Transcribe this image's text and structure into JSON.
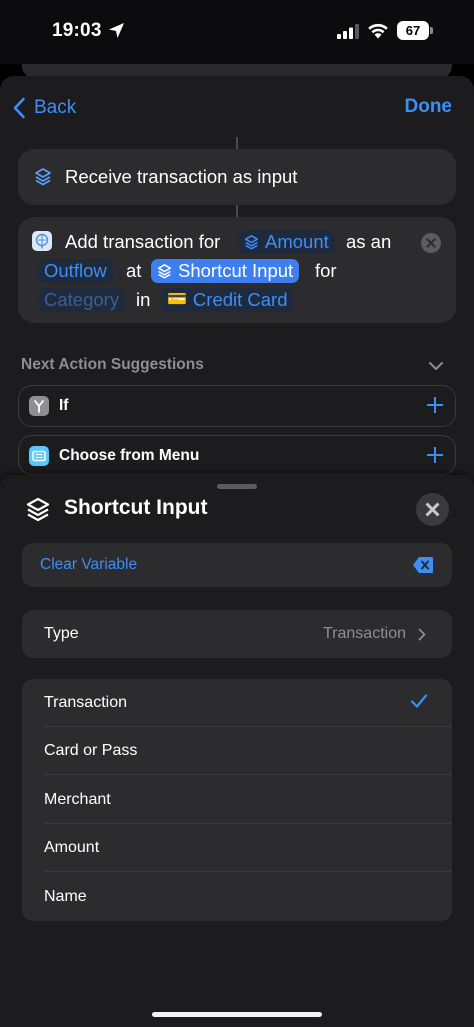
{
  "status_bar": {
    "time": "19:03",
    "battery": "67",
    "icons": [
      "location-arrow-icon",
      "cellular-signal-icon",
      "wifi-icon",
      "battery-icon"
    ]
  },
  "nav": {
    "back_label": "Back",
    "done_label": "Done"
  },
  "actions": {
    "receive": {
      "label": "Receive transaction as input",
      "icon": "shortcuts-icon"
    },
    "add_transaction": {
      "icon": "wallet-app-icon",
      "text_1": "Add transaction for",
      "amount_token": "Amount",
      "text_2": "as an",
      "direction_token": "Outflow",
      "text_3": "at",
      "shortcut_input_token": "Shortcut Input",
      "text_4": "for",
      "category_token": "Category",
      "text_5": "in",
      "card_emoji": "💳",
      "account_token": "Credit Card"
    }
  },
  "suggestions": {
    "title": "Next Action Suggestions",
    "items": [
      {
        "label": "If",
        "icon": "if-branch-icon"
      },
      {
        "label": "Choose from Menu",
        "icon": "menu-icon"
      }
    ]
  },
  "variable_panel": {
    "title": "Shortcut Input",
    "clear_label": "Clear Variable",
    "type_label": "Type",
    "type_value": "Transaction",
    "options": [
      "Transaction",
      "Card or Pass",
      "Merchant",
      "Amount",
      "Name"
    ],
    "selected": "Transaction"
  },
  "colors": {
    "accent": "#3d8ef7",
    "background": "#1c1c1e",
    "card": "#2c2c2e",
    "secondary_text": "#8d8d93"
  }
}
